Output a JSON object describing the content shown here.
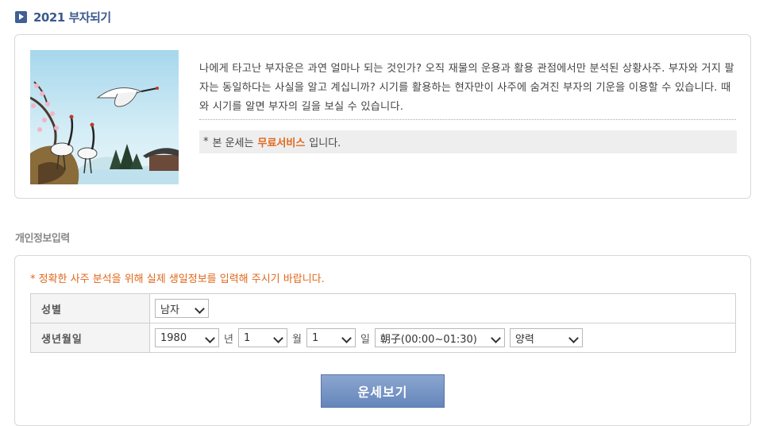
{
  "header": {
    "title": "2021 부자되기",
    "icon": "play-icon"
  },
  "intro": {
    "text": "나에게 타고난 부자운은 과연 얼마나 되는 것인가? 오직 재물의 운용과 활용 관점에서만 분석된 상황사주. 부자와 거지 팔자는 동일하다는 사실을 알고 계십니까? 시기를 활용하는 현자만이 사주에 숨겨진 부자의 기운을 이용할 수 있습니다. 때와 시기를 알면 부자의 길을 보실 수 있습니다.",
    "free_prefix": "본 운세는",
    "free_highlight": "무료서비스",
    "free_suffix": "입니다."
  },
  "form": {
    "section_title": "개인정보입력",
    "notice": "* 정확한 사주 분석을 위해 실제 생일정보를 입력해 주시기 바랍니다.",
    "gender_label": "성별",
    "gender_value": "남자",
    "birth_label": "생년월일",
    "year_value": "1980",
    "year_unit": "년",
    "month_value": "1",
    "month_unit": "월",
    "day_value": "1",
    "day_unit": "일",
    "hour_value": "朝子(00:00~01:30)",
    "calendar_value": "양력",
    "submit_label": "운세보기"
  },
  "colors": {
    "accent": "#e0671b",
    "title": "#3a5a8c",
    "button": "#6f8cc0"
  }
}
